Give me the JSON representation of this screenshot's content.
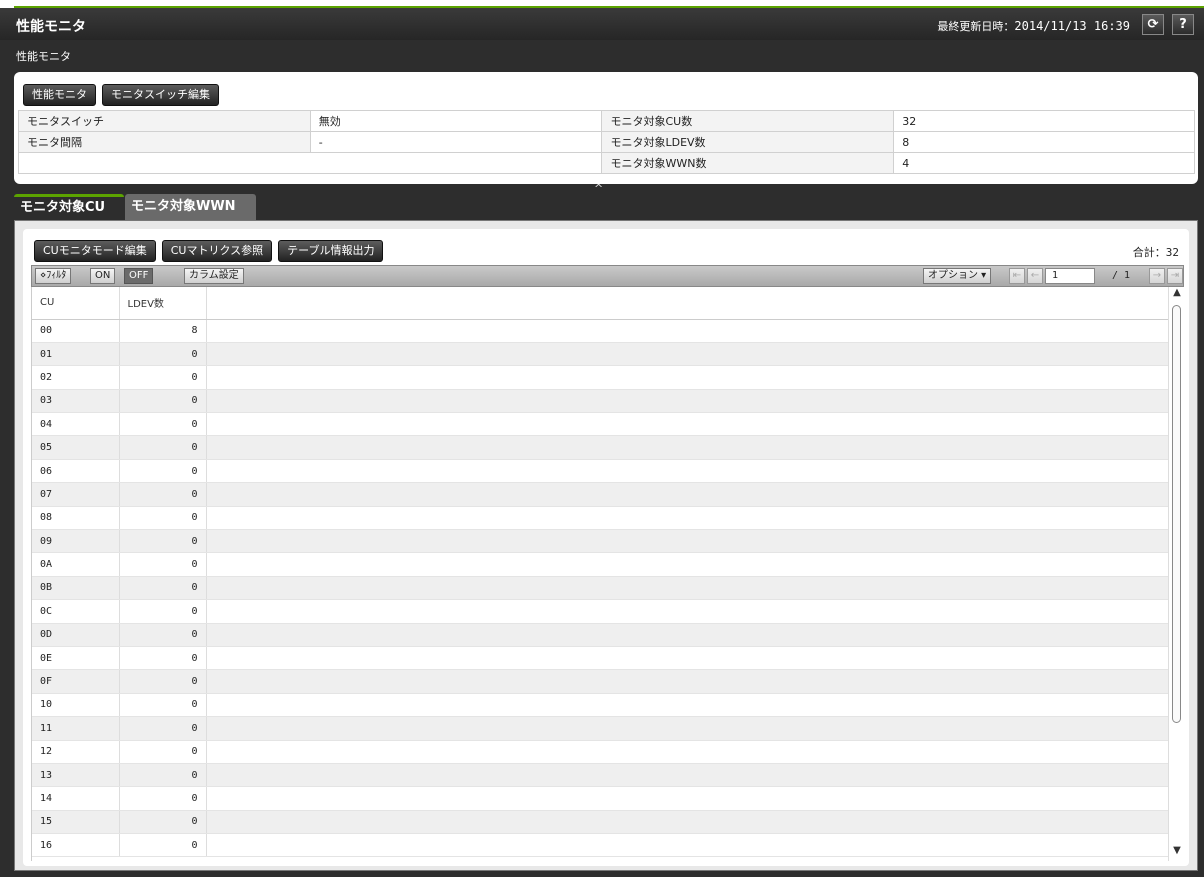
{
  "header": {
    "title": "性能モニタ",
    "last_updated_label": "最終更新日時：",
    "last_updated_value": "2014/11/13 16:39",
    "refresh_icon": "refresh-icon",
    "help_label": "?"
  },
  "breadcrumb": "性能モニタ",
  "summary": {
    "buttons": [
      "性能モニタ",
      "モニタスイッチ編集"
    ],
    "rows": [
      {
        "label1": "モニタスイッチ",
        "value1": "無効",
        "label2": "モニタ対象CU数",
        "value2": "32"
      },
      {
        "label1": "モニタ間隔",
        "value1": "-",
        "label2": "モニタ対象LDEV数",
        "value2": "8"
      },
      {
        "label1": "",
        "value1": "",
        "label2": "モニタ対象WWN数",
        "value2": "4"
      }
    ]
  },
  "collapse_caret": "^",
  "tabs": [
    "モニタ対象CU",
    "モニタ対象WWN"
  ],
  "cu_panel": {
    "buttons": [
      "CUモニタモード編集",
      "CUマトリクス参照",
      "テーブル情報出力"
    ],
    "total_label": "合計：",
    "total_value": "32",
    "filter_label": "ﾌｨﾙﾀ",
    "filter_on": "ON",
    "filter_off": "OFF",
    "column_settings": "カラム設定",
    "options_label": "オプション ▾",
    "page_current": "1",
    "page_total": "/ 1",
    "columns": [
      "CU",
      "LDEV数"
    ],
    "rows": [
      [
        "00",
        "8"
      ],
      [
        "01",
        "0"
      ],
      [
        "02",
        "0"
      ],
      [
        "03",
        "0"
      ],
      [
        "04",
        "0"
      ],
      [
        "05",
        "0"
      ],
      [
        "06",
        "0"
      ],
      [
        "07",
        "0"
      ],
      [
        "08",
        "0"
      ],
      [
        "09",
        "0"
      ],
      [
        "0A",
        "0"
      ],
      [
        "0B",
        "0"
      ],
      [
        "0C",
        "0"
      ],
      [
        "0D",
        "0"
      ],
      [
        "0E",
        "0"
      ],
      [
        "0F",
        "0"
      ],
      [
        "10",
        "0"
      ],
      [
        "11",
        "0"
      ],
      [
        "12",
        "0"
      ],
      [
        "13",
        "0"
      ],
      [
        "14",
        "0"
      ],
      [
        "15",
        "0"
      ],
      [
        "16",
        "0"
      ]
    ]
  },
  "colors": {
    "accent": "#5ca300",
    "dark_bg": "#2d2d2d"
  }
}
